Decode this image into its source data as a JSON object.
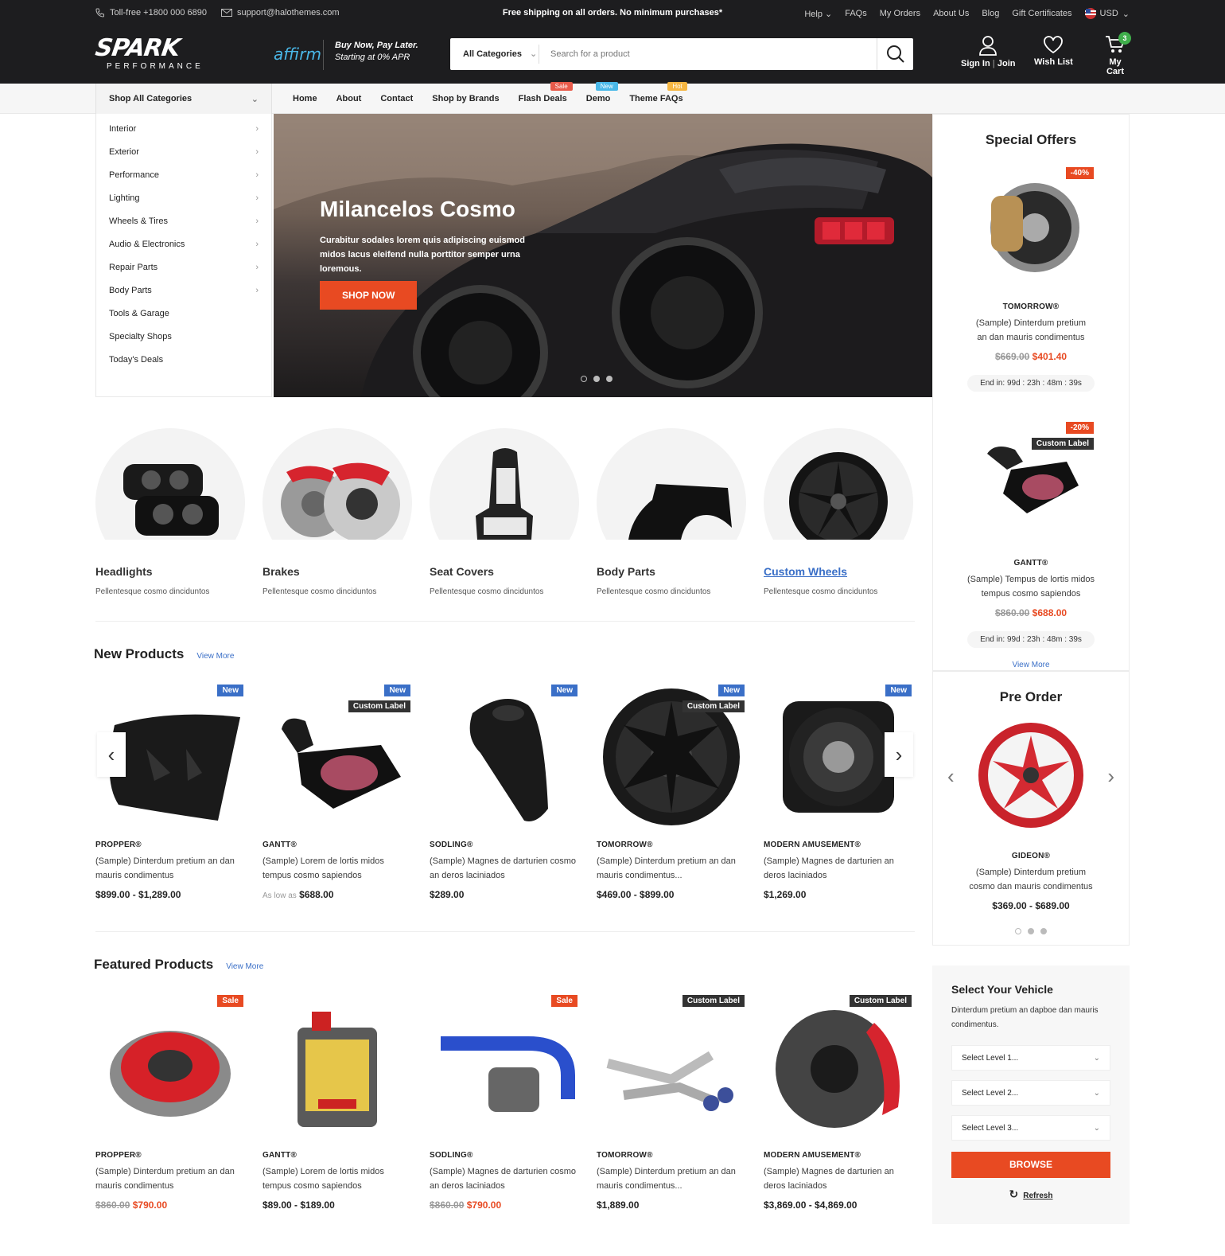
{
  "topbar": {
    "phone": "Toll-free +1800 000 6890",
    "email": "support@halothemes.com",
    "promo": "Free shipping on all orders. No minimum purchases*",
    "links": [
      "Help",
      "FAQs",
      "My Orders",
      "About Us",
      "Blog",
      "Gift Certificates"
    ],
    "currency": "USD"
  },
  "header": {
    "logo_word": "SPARK",
    "logo_sub": "PERFORMANCE",
    "affirm": "affirm",
    "bnpl_title": "Buy Now, Pay Later.",
    "bnpl_sub": "Starting at 0% APR",
    "search_category": "All Categories",
    "search_placeholder": "Search for a product",
    "sign_in": "Sign In",
    "join": "Join",
    "wishlist": "Wish List",
    "cart": "My Cart",
    "cart_count": "3"
  },
  "nav": {
    "shop_all": "Shop All Categories",
    "links": [
      "Home",
      "About",
      "Contact",
      "Shop by Brands",
      "Flash Deals",
      "Demo",
      "Theme FAQs"
    ],
    "tags": {
      "sale": "Sale",
      "new": "New",
      "hot": "Hot"
    }
  },
  "sidebar": [
    "Interior",
    "Exterior",
    "Performance",
    "Lighting",
    "Wheels & Tires",
    "Audio & Electronics",
    "Repair Parts",
    "Body Parts",
    "Tools & Garage",
    "Specialty Shops",
    "Today's Deals"
  ],
  "hero": {
    "title": "Milancelos Cosmo",
    "text": "Curabitur sodales lorem quis adipiscing euismod midos lacus eleifend nulla porttitor semper urna loremous.",
    "button": "SHOP NOW"
  },
  "categories": [
    {
      "title": "Headlights",
      "desc": "Pellentesque cosmo dinciduntоs"
    },
    {
      "title": "Brakes",
      "desc": "Pellentesque cosmo dinciduntоs"
    },
    {
      "title": "Seat Covers",
      "desc": "Pellentesque cosmo dinciduntоs"
    },
    {
      "title": "Body Parts",
      "desc": "Pellentesque cosmo dinciduntоs"
    },
    {
      "title": "Custom Wheels",
      "desc": "Pellentesque cosmo dinciduntоs"
    }
  ],
  "new_products": {
    "title": "New Products",
    "view_more": "View More",
    "items": [
      {
        "brand": "PROPPER®",
        "name": "(Sample) Dinterdum pretium an dan mauris condimentus",
        "price": "$899.00 - $1,289.00",
        "badge": "New"
      },
      {
        "brand": "GANTT®",
        "name": "(Sample) Lorem de lortis midos tempus cosmo sapiendos",
        "prefix": "As low as",
        "price": "$688.00",
        "badge": "New",
        "label": "Custom Label"
      },
      {
        "brand": "SODLING®",
        "name": "(Sample) Magnes de darturien cosmo an deros laciniados",
        "price": "$289.00",
        "badge": "New"
      },
      {
        "brand": "TOMORROW®",
        "name": "(Sample) Dinterdum pretium an dan mauris condimentus...",
        "price": "$469.00 - $899.00",
        "badge": "New",
        "label": "Custom Label"
      },
      {
        "brand": "MODERN AMUSEMENT®",
        "name": "(Sample) Magnes de darturien an deros laciniados",
        "price": "$1,269.00",
        "badge": "New"
      }
    ]
  },
  "featured_products": {
    "title": "Featured Products",
    "view_more": "View More",
    "items": [
      {
        "brand": "PROPPER®",
        "name": "(Sample) Dinterdum pretium an dan mauris condimentus",
        "old": "$860.00",
        "price": "$790.00",
        "badge": "Sale"
      },
      {
        "brand": "GANTT®",
        "name": "(Sample) Lorem de lortis midos tempus cosmo sapiendos",
        "price": "$89.00 - $189.00"
      },
      {
        "brand": "SODLING®",
        "name": "(Sample) Magnes de darturien cosmo an deros laciniados",
        "old": "$860.00",
        "price": "$790.00",
        "badge": "Sale"
      },
      {
        "brand": "TOMORROW®",
        "name": "(Sample) Dinterdum pretium an dan mauris condimentus...",
        "price": "$1,889.00",
        "label": "Custom Label"
      },
      {
        "brand": "MODERN AMUSEMENT®",
        "name": "(Sample) Magnes de darturien an deros laciniados",
        "price": "$3,869.00 - $4,869.00",
        "label": "Custom Label"
      }
    ]
  },
  "special_offers": {
    "title": "Special Offers",
    "items": [
      {
        "discount": "-40%",
        "brand": "TOMORROW®",
        "name": "(Sample) Dinterdum pretium an dan mauris condimentus",
        "old": "$669.00",
        "price": "$401.40",
        "timer": "End in: 99d : 23h : 48m : 39s"
      },
      {
        "discount": "-20%",
        "label": "Custom Label",
        "brand": "GANTT®",
        "name": "(Sample) Tempus de lortis midos tempus cosmo sapiendos",
        "old": "$860.00",
        "price": "$688.00",
        "timer": "End in: 99d : 23h : 48m : 39s"
      }
    ],
    "view_more": "View More"
  },
  "preorder": {
    "title": "Pre Order",
    "brand": "GIDEON®",
    "name": "(Sample) Dinterdum pretium cosmo dan mauris condimentus",
    "price": "$369.00 - $689.00"
  },
  "vehicle": {
    "title": "Select Your Vehicle",
    "desc": "Dinterdum pretium an dapboe dan mauris condimentus.",
    "levels": [
      "Select Level 1...",
      "Select Level 2...",
      "Select Level 3..."
    ],
    "browse": "BROWSE",
    "refresh": "Refresh"
  },
  "colors": {
    "accent": "#e84a22",
    "dark": "#1d1d1f",
    "new_badge": "#3a6fc7",
    "cart_badge": "#3fae4b"
  }
}
